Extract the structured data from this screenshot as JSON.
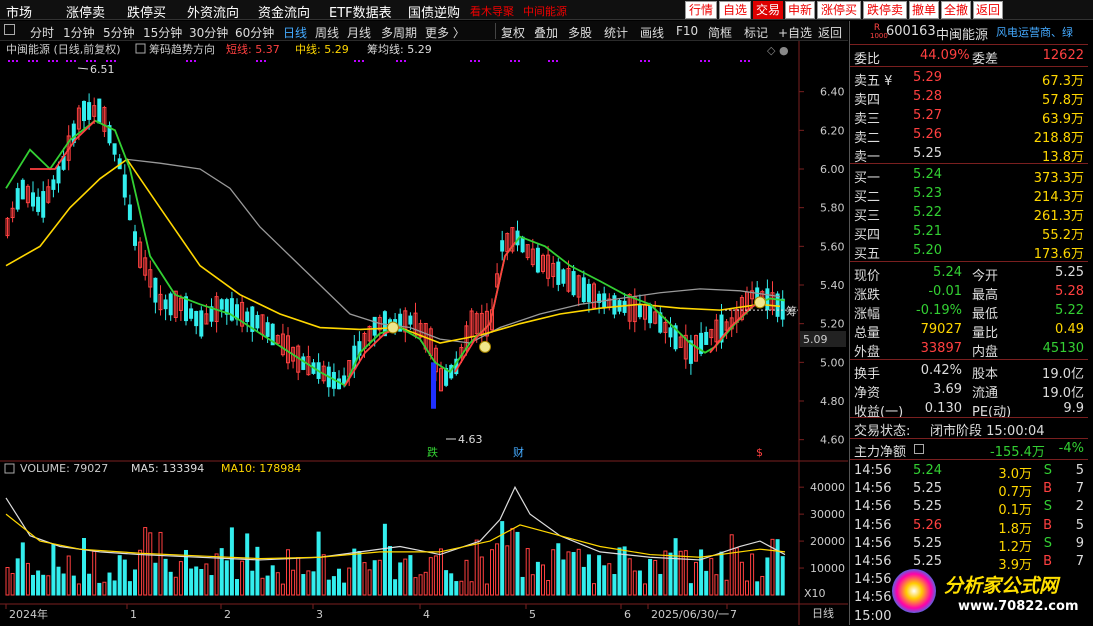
{
  "menu": {
    "items": [
      "市场",
      "涨停卖",
      "跌停买",
      "外资流向",
      "资金流向",
      "ETF数据表",
      "国债逆购"
    ],
    "red_text": [
      "看木导聚",
      "中间能源"
    ],
    "right_buttons": [
      "行情",
      "自选",
      "交易",
      "申新",
      "涨停买",
      "跌停卖",
      "撤单",
      "全撤",
      "返回"
    ]
  },
  "toolbar": {
    "periods": [
      "分时",
      "1分钟",
      "5分钟",
      "15分钟",
      "30分钟",
      "60分钟",
      "日线",
      "周线",
      "月线",
      "多周期",
      "更多 〉"
    ],
    "selected_period": "日线",
    "tools": [
      "复权",
      "叠加",
      "多股",
      "统计",
      "画线",
      "F10",
      "简框",
      "标记",
      "+自选",
      "返回"
    ]
  },
  "chart_header": {
    "title": "中闽能源 (日线,前复权)",
    "indicator": "筹码趋势方向",
    "short_label": "短线: 5.37",
    "mid_label": "中线: 5.29",
    "avg_label": "筹均线: 5.29"
  },
  "price_axis": {
    "ticks": [
      "6.40",
      "6.20",
      "6.00",
      "5.80",
      "5.60",
      "5.40",
      "5.20",
      "5.00",
      "4.80",
      "4.60"
    ],
    "current": "5.09"
  },
  "annotations": {
    "high": "6.51",
    "low": "4.63",
    "die": "跌",
    "cai": "财",
    "dollar": "$",
    "chou": "筹"
  },
  "volume_header": {
    "volume": "VOLUME: 79027",
    "ma5": "MA5: 133394",
    "ma10": "MA10: 178984"
  },
  "volume_axis": {
    "ticks": [
      "40000",
      "30000",
      "20000",
      "10000"
    ],
    "unit": "X10"
  },
  "date_axis": {
    "labels": [
      "2024年",
      "1",
      "2",
      "3",
      "4",
      "5",
      "6",
      "2025/06/30/一",
      "7"
    ],
    "period": "日线"
  },
  "quote": {
    "code": "600163",
    "name": "中闽能源",
    "sector": "风电运营商、绿",
    "badge": [
      "R",
      "1000"
    ],
    "weibi_label": "委比",
    "weibi": "44.09%",
    "weicha_label": "委差",
    "weicha": "12622",
    "asks": [
      {
        "label": "卖五 ¥",
        "price": "5.29",
        "vol": "67.3万"
      },
      {
        "label": "卖四",
        "price": "5.28",
        "vol": "57.8万"
      },
      {
        "label": "卖三",
        "price": "5.27",
        "vol": "63.9万"
      },
      {
        "label": "卖二",
        "price": "5.26",
        "vol": "218.8万"
      },
      {
        "label": "卖一",
        "price": "5.25",
        "vol": "13.8万"
      }
    ],
    "bids": [
      {
        "label": "买一",
        "price": "5.24",
        "vol": "373.3万"
      },
      {
        "label": "买二",
        "price": "5.23",
        "vol": "214.3万"
      },
      {
        "label": "买三",
        "price": "5.22",
        "vol": "261.3万"
      },
      {
        "label": "买四",
        "price": "5.21",
        "vol": "55.2万"
      },
      {
        "label": "买五",
        "price": "5.20",
        "vol": "173.6万"
      }
    ],
    "stats": [
      {
        "l1": "现价",
        "v1": "5.24",
        "c1": "green",
        "l2": "今开",
        "v2": "5.25",
        "c2": "white"
      },
      {
        "l1": "涨跌",
        "v1": "-0.01",
        "c1": "green",
        "l2": "最高",
        "v2": "5.28",
        "c2": "red"
      },
      {
        "l1": "涨幅",
        "v1": "-0.19%",
        "c1": "green",
        "l2": "最低",
        "v2": "5.22",
        "c2": "green"
      },
      {
        "l1": "总量",
        "v1": "79027",
        "c1": "yellow",
        "l2": "量比",
        "v2": "0.49",
        "c2": "yellow"
      },
      {
        "l1": "外盘",
        "v1": "33897",
        "c1": "red",
        "l2": "内盘",
        "v2": "45130",
        "c2": "green"
      }
    ],
    "stats2": [
      {
        "l1": "换手",
        "v1": "0.42%",
        "l2": "股本",
        "v2": "19.0亿"
      },
      {
        "l1": "净资",
        "v1": "3.69",
        "l2": "流通",
        "v2": "19.0亿"
      },
      {
        "l1": "收益(一)",
        "v1": "0.130",
        "l2": "PE(动)",
        "v2": "9.9"
      }
    ],
    "status_label": "交易状态:",
    "status": "闭市阶段 15:00:04",
    "flow_label": "主力净额",
    "flow_value": "-155.4万",
    "flow_pct": "-4%",
    "ticks": [
      {
        "t": "14:56",
        "p": "5.24",
        "pc": "green",
        "v": "3.0万",
        "s": "S",
        "n": "5"
      },
      {
        "t": "14:56",
        "p": "5.25",
        "pc": "white",
        "v": "0.7万",
        "s": "B",
        "n": "7"
      },
      {
        "t": "14:56",
        "p": "5.25",
        "pc": "white",
        "v": "0.1万",
        "s": "S",
        "n": "2"
      },
      {
        "t": "14:56",
        "p": "5.26",
        "pc": "red",
        "v": "1.8万",
        "s": "B",
        "n": "5"
      },
      {
        "t": "14:56",
        "p": "5.25",
        "pc": "white",
        "v": "1.2万",
        "s": "S",
        "n": "9"
      },
      {
        "t": "14:56",
        "p": "5.25",
        "pc": "white",
        "v": "3.9万",
        "s": "B",
        "n": "7"
      },
      {
        "t": "14:56",
        "p": "",
        "pc": "white",
        "v": "",
        "s": "",
        "n": ""
      },
      {
        "t": "14:56",
        "p": "",
        "pc": "white",
        "v": "",
        "s": "",
        "n": ""
      },
      {
        "t": "15:00",
        "p": "",
        "pc": "white",
        "v": "",
        "s": "",
        "n": ""
      }
    ]
  },
  "watermark": {
    "title": "分析家公式网",
    "url": "www.70822.com"
  },
  "colors": {
    "up": "#ff4040",
    "down": "#3ee",
    "short": "#33d033",
    "mid": "#ffd700",
    "avg": "#999999"
  }
}
